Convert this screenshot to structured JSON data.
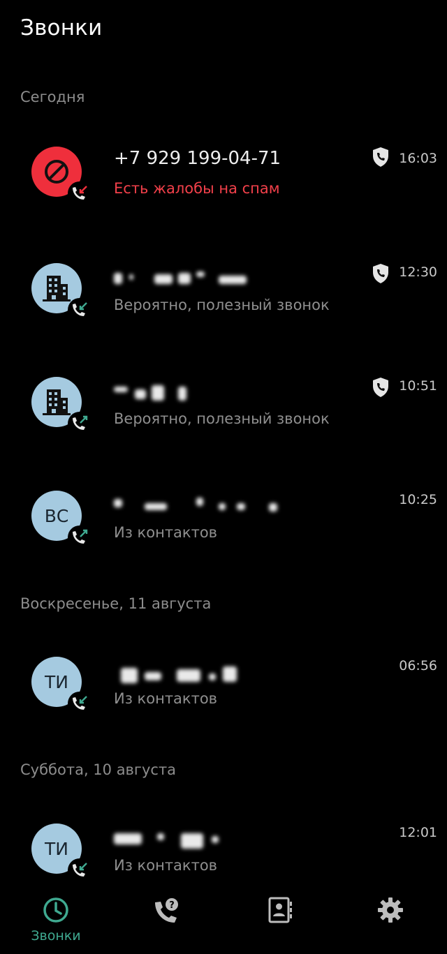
{
  "app": {
    "title": "Звонки"
  },
  "sections": [
    {
      "label": "Сегодня"
    },
    {
      "label": "Воскресенье, 11 августа"
    },
    {
      "label": "Суббота, 10 августа"
    }
  ],
  "calls": [
    {
      "name": "+7 929 199-04-71",
      "sub": "Есть жалобы на спам",
      "time": "16:03",
      "avatar": "spam-block-icon",
      "direction": "missed",
      "shield": true
    },
    {
      "name": "",
      "sub": "Вероятно, полезный звонок",
      "time": "12:30",
      "avatar": "building-icon",
      "direction": "incoming",
      "shield": true
    },
    {
      "name": "",
      "sub": "Вероятно, полезный звонок",
      "time": "10:51",
      "avatar": "building-icon",
      "direction": "outgoing",
      "shield": true
    },
    {
      "name": "",
      "initials": "ВС",
      "sub": "Из контактов",
      "time": "10:25",
      "direction": "outgoing",
      "shield": false
    },
    {
      "name": "",
      "initials": "ТИ",
      "sub": "Из контактов",
      "time": "06:56",
      "direction": "incoming",
      "shield": false
    },
    {
      "name": "",
      "initials": "ТИ",
      "sub": "Из контактов",
      "time": "12:01",
      "direction": "incoming",
      "shield": false
    }
  ],
  "nav": {
    "calls_label": "Звонки",
    "active_color": "#3fa990"
  },
  "colors": {
    "spam": "#ef2f3c",
    "avatar": "#a5cae0",
    "accent": "#3fa990",
    "missed_arrow": "#ef2f3c",
    "call_arrow": "#3fa990"
  }
}
